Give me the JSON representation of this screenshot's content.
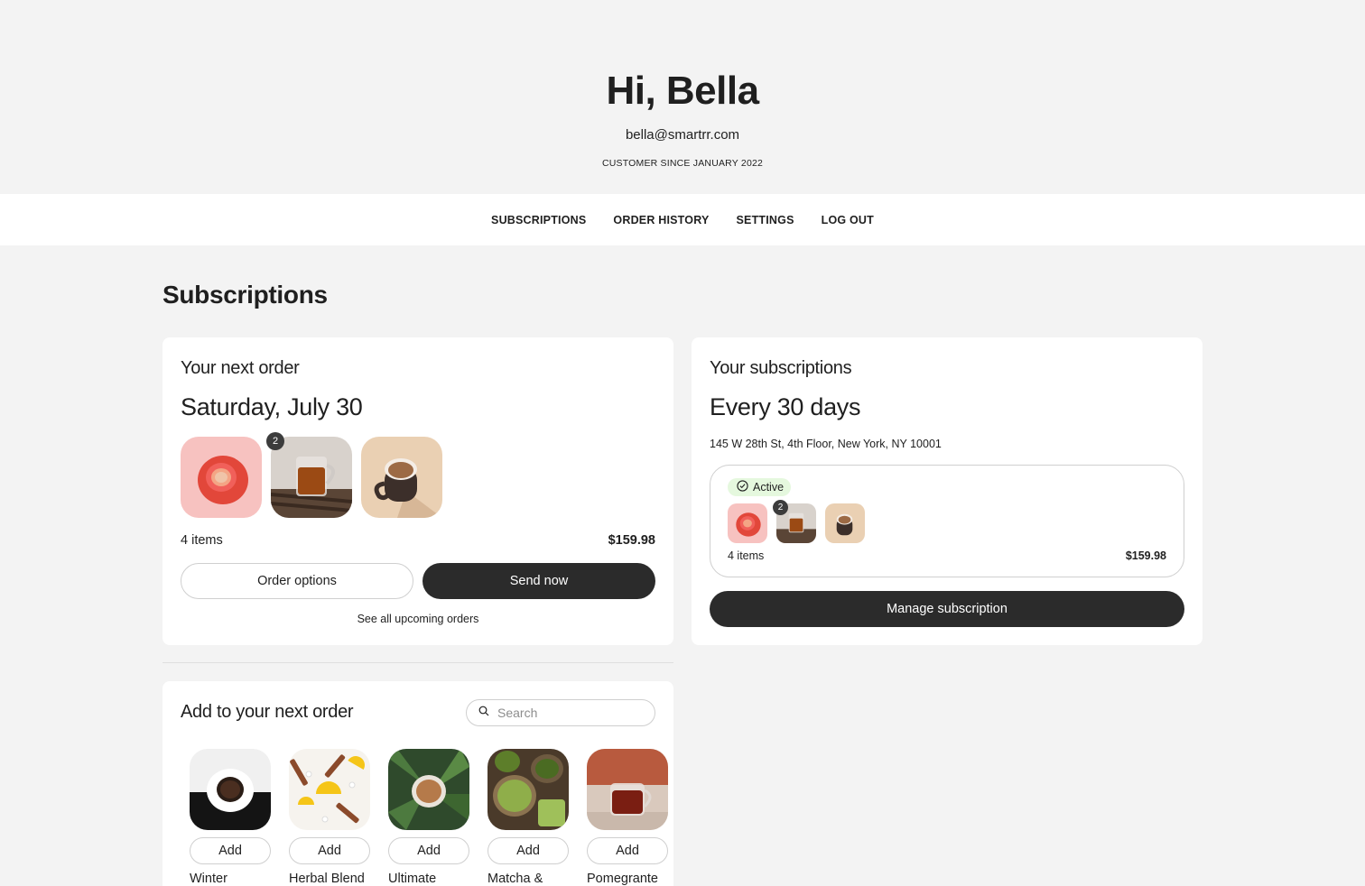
{
  "header": {
    "greeting": "Hi, Bella",
    "email": "bella@smartrr.com",
    "customer_since": "CUSTOMER SINCE JANUARY 2022"
  },
  "nav": {
    "items": [
      "SUBSCRIPTIONS",
      "ORDER HISTORY",
      "SETTINGS",
      "LOG OUT"
    ]
  },
  "page_title": "Subscriptions",
  "next_order": {
    "heading": "Your next order",
    "date": "Saturday, July 30",
    "thumb_badge": "2",
    "items_count": "4 items",
    "total": "$159.98",
    "order_options_label": "Order options",
    "send_now_label": "Send now",
    "see_all_label": "See all upcoming orders"
  },
  "subscriptions": {
    "heading": "Your subscriptions",
    "frequency": "Every 30 days",
    "address": "145 W 28th St, 4th Floor, New York, NY 10001",
    "status": "Active",
    "thumb_badge": "2",
    "items_count": "4 items",
    "total": "$159.98",
    "manage_label": "Manage subscription"
  },
  "add_section": {
    "heading": "Add to your next order",
    "search_placeholder": "Search",
    "add_label": "Add",
    "products": [
      {
        "name": "Winter"
      },
      {
        "name": "Herbal Blend"
      },
      {
        "name": "Ultimate"
      },
      {
        "name": "Matcha &"
      },
      {
        "name": "Pomegrante"
      }
    ]
  },
  "colors": {
    "page_bg": "#f3f3f3",
    "card_bg": "#ffffff",
    "dark_button": "#2b2b2b",
    "active_pill": "#e5f8de"
  },
  "icons": [
    "search-icon",
    "check-circle-icon"
  ]
}
